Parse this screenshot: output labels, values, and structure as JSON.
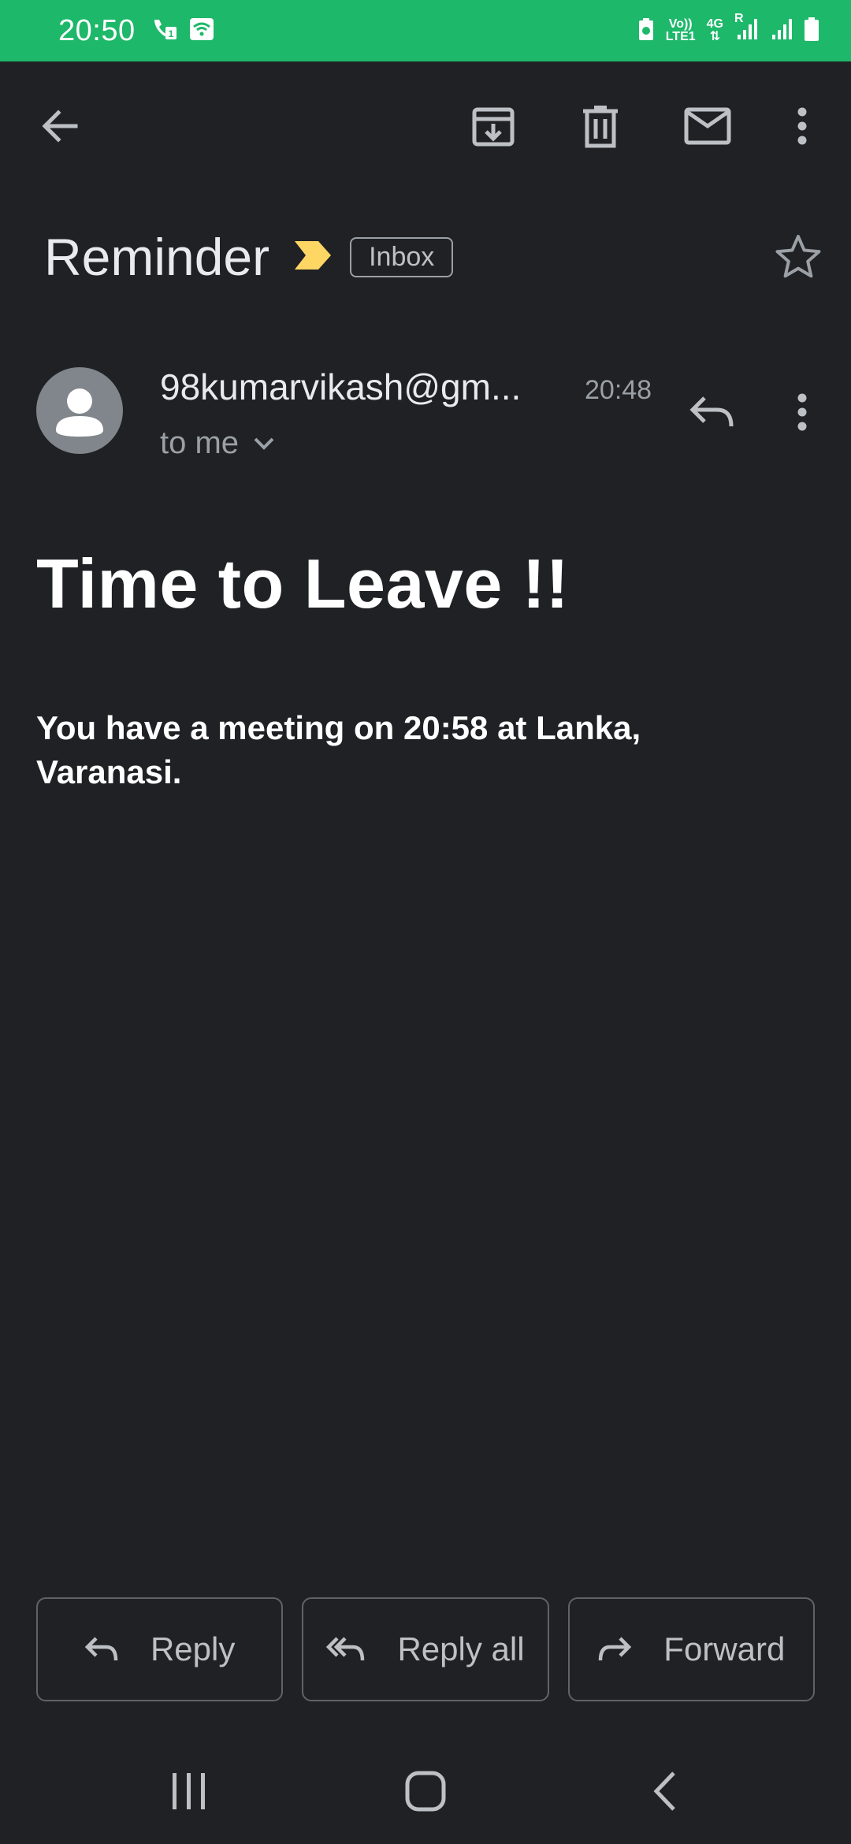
{
  "status_bar": {
    "time": "20:50",
    "volte_label_top": "Vo))",
    "volte_label_bottom": "LTE1",
    "network_label": "4G",
    "roaming_label": "R",
    "background_color": "#1db86a"
  },
  "toolbar": {
    "icons": [
      "back-arrow-icon",
      "archive-icon",
      "delete-icon",
      "mark-unread-icon",
      "more-vert-icon"
    ]
  },
  "email": {
    "subject": "Reminder",
    "label": "Inbox",
    "importance_color": "#fdd663",
    "sender": "98kumarvikash@gm...",
    "time": "20:48",
    "recipient": "to me",
    "heading": "Time to Leave !!",
    "body": "You have a meeting on 20:58 at Lanka, Varanasi."
  },
  "actions": {
    "reply": "Reply",
    "reply_all": "Reply all",
    "forward": "Forward"
  },
  "nav": {
    "icons": [
      "recent-apps-icon",
      "home-icon",
      "back-icon"
    ]
  }
}
